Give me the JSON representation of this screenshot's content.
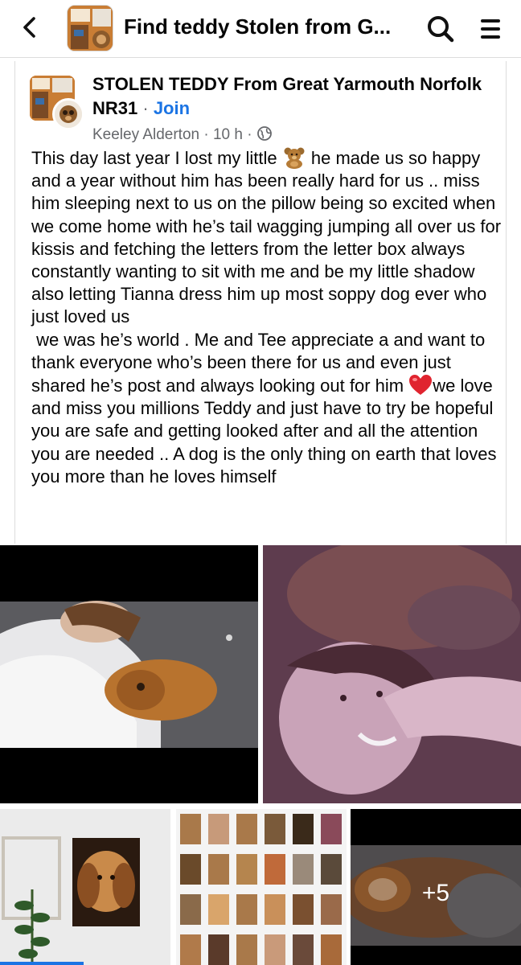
{
  "header": {
    "title": "Find teddy Stolen from G...",
    "back_icon": "chevron-left-icon",
    "search_icon": "search-icon",
    "menu_icon": "hamburger-menu-icon"
  },
  "post": {
    "group_name": "STOLEN TEDDY  From Great Yarmouth Norfolk NR31",
    "separator": " · ",
    "join_label": "Join",
    "author": "Keeley Alderton",
    "time": "10 h",
    "privacy_icon": "globe-icon",
    "body_part1": "This day last year I lost my little ",
    "body_emoji1": "teddy-bear-emoji",
    "body_part2": " he made us so happy and a year without him has been really hard for us .. miss him sleeping next to us on the pillow being so excited when we come home with he’s tail wagging jumping all over us for kissis and fetching the letters from the letter box always constantly wanting to sit with me and be my little shadow also letting Tianna dress him up most soppy dog ever who just loved us\n we was he’s world . Me and Tee appreciate a and want to thank everyone who’s been there for us and even just shared he’s post and always looking out for him ",
    "body_emoji2": "red-heart-emoji",
    "body_part3": "we love and miss you millions Teddy and just have to try be hopeful you are safe and getting looked after and all the attention you are needed .. A dog is the only thing on earth that loves you more than he loves himself"
  },
  "photos": {
    "more_count": "+5"
  },
  "colors": {
    "link_blue": "#1b74e4",
    "meta_gray": "#65676b",
    "text": "#050505"
  }
}
